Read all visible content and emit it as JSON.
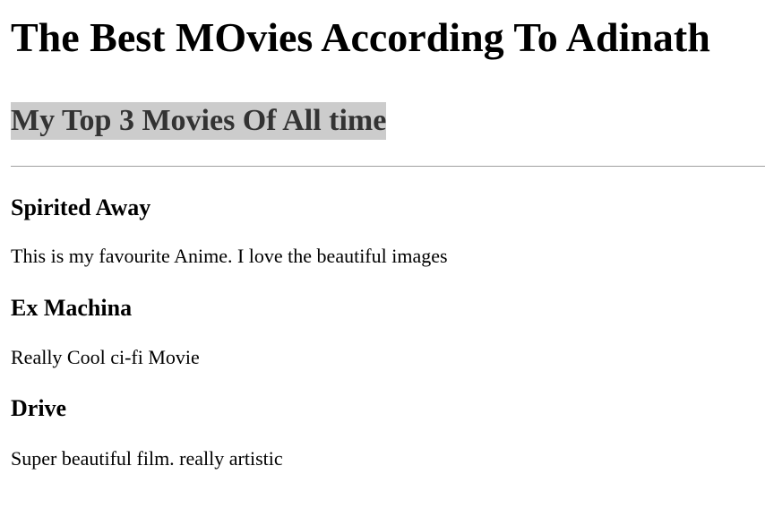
{
  "page": {
    "title": "The Best MOvies According To Adinath",
    "subtitle": "My Top 3 Movies Of All time"
  },
  "movies": [
    {
      "name": "Spirited Away",
      "description": "This is my favourite Anime. I love the beautiful images"
    },
    {
      "name": "Ex Machina",
      "description": "Really Cool ci-fi Movie"
    },
    {
      "name": "Drive",
      "description": "Super beautiful film. really artistic"
    }
  ],
  "colors": {
    "subtitle_background": "#cccccc",
    "subtitle_text": "#333333",
    "divider": "#a0a0a0"
  }
}
